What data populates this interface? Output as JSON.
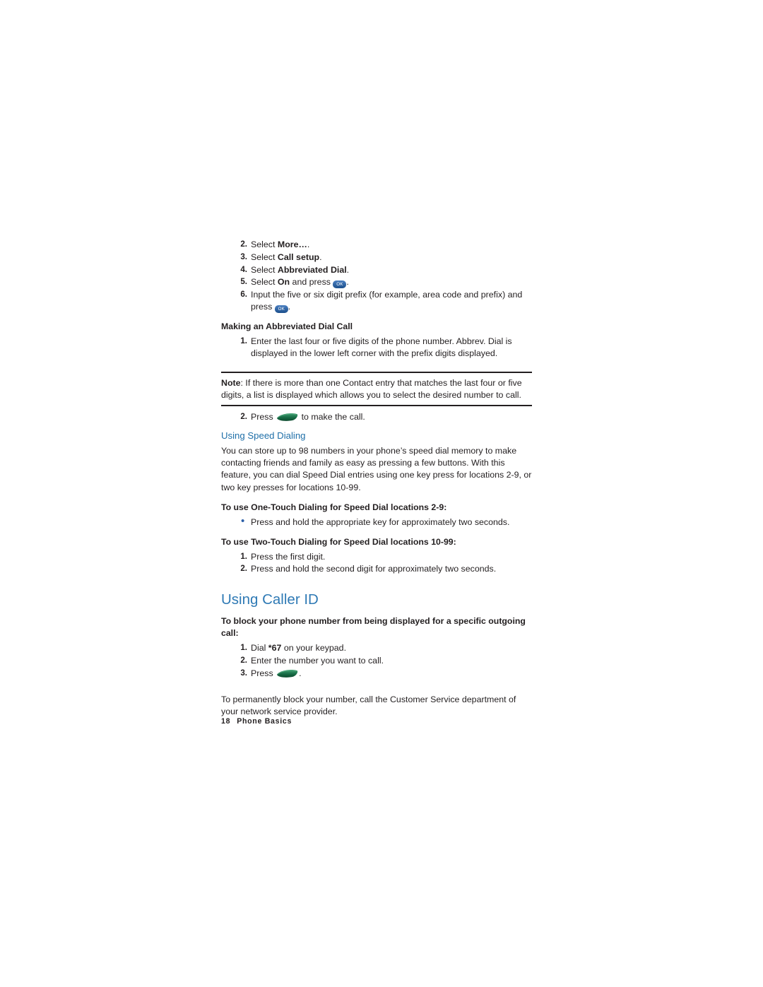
{
  "steps_top": [
    {
      "num": "2.",
      "html": "Select <b>More…</b>."
    },
    {
      "num": "3.",
      "html": "Select <b>Call setup</b>."
    },
    {
      "num": "4.",
      "html": "Select <b>Abbreviated Dial</b>."
    },
    {
      "num": "5.",
      "html": "Select <b>On</b> and press <span class=\"key-ok\">OK</span>."
    },
    {
      "num": "6.",
      "html": "Input the five or six digit prefix (for example, area code and prefix) and press <span class=\"key-ok\">OK</span>."
    }
  ],
  "heading_abbrev_call": "Making an Abbreviated Dial Call",
  "steps_abbrev": [
    {
      "num": "1.",
      "html": "Enter the last four or five digits of the phone number. Abbrev. Dial is displayed in the lower left corner with the prefix digits displayed."
    }
  ],
  "note": {
    "label": "Note",
    "text": ": If there is more than one Contact entry that matches the last four or five digits, a list is displayed which allows you to select the desired number to call."
  },
  "steps_after_note": [
    {
      "num": "2.",
      "html": "Press <span class=\"key-send\"></span> to make the call."
    }
  ],
  "heading_speed_dialing": "Using Speed Dialing",
  "para_speed_dialing": "You can store up to 98 numbers in your phone’s speed dial memory to make contacting friends and family as easy as pressing a few buttons. With this feature, you can dial Speed Dial entries using one key press for locations 2-9, or two key presses for locations 10-99.",
  "heading_one_touch": "To use One-Touch Dialing for Speed Dial locations 2-9:",
  "bullet_one_touch": "Press and hold the appropriate key for approximately two seconds.",
  "heading_two_touch": "To use Two-Touch Dialing for Speed Dial locations 10-99:",
  "steps_two_touch": [
    {
      "num": "1.",
      "html": "Press the first digit."
    },
    {
      "num": "2.",
      "html": "Press and hold the second digit for approximately two seconds."
    }
  ],
  "heading_caller_id": "Using Caller ID",
  "heading_block": "To block your phone number from being displayed for a specific outgoing call:",
  "steps_block": [
    {
      "num": "1.",
      "html": "Dial <b>*67</b> on your keypad."
    },
    {
      "num": "2.",
      "html": "Enter the number you want to call."
    },
    {
      "num": "3.",
      "html": "Press <span class=\"key-send\"></span>."
    }
  ],
  "para_permanent": "To permanently block your number, call the Customer Service department of your network service provider.",
  "footer": {
    "page_number": "18",
    "section": "Phone Basics"
  },
  "colors": {
    "heading_teal": "#1f6fa8",
    "heading_blue": "#2f7ab5",
    "bullet_blue": "#2b5fa8",
    "key_blue": "#2a5f9e",
    "send_green": "#1f6e4a",
    "text": "#231f20"
  }
}
